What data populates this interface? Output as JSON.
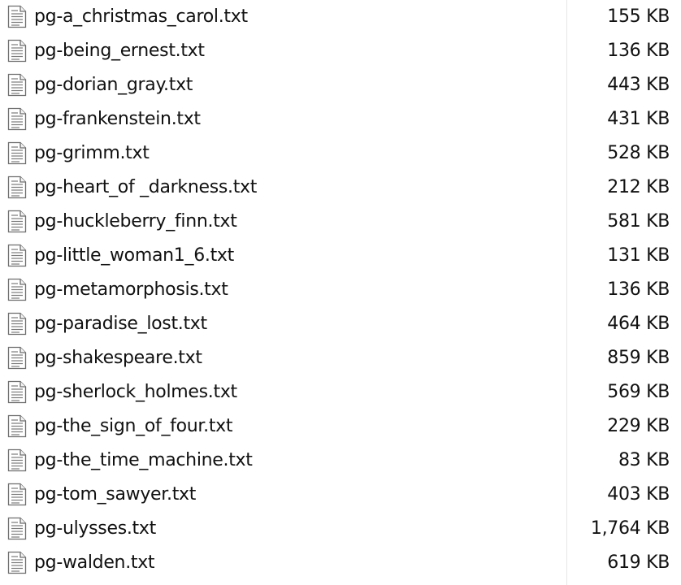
{
  "file_list": {
    "rows": [
      {
        "name": "pg-a_christmas_carol.txt",
        "size": "155 KB",
        "icon": "text-document-icon"
      },
      {
        "name": "pg-being_ernest.txt",
        "size": "136 KB",
        "icon": "text-document-icon"
      },
      {
        "name": "pg-dorian_gray.txt",
        "size": "443 KB",
        "icon": "text-document-icon"
      },
      {
        "name": "pg-frankenstein.txt",
        "size": "431 KB",
        "icon": "text-document-icon"
      },
      {
        "name": "pg-grimm.txt",
        "size": "528 KB",
        "icon": "text-document-icon"
      },
      {
        "name": "pg-heart_of _darkness.txt",
        "size": "212 KB",
        "icon": "text-document-icon"
      },
      {
        "name": "pg-huckleberry_finn.txt",
        "size": "581 KB",
        "icon": "text-document-icon"
      },
      {
        "name": "pg-little_woman1_6.txt",
        "size": "131 KB",
        "icon": "text-document-icon"
      },
      {
        "name": "pg-metamorphosis.txt",
        "size": "136 KB",
        "icon": "text-document-icon"
      },
      {
        "name": "pg-paradise_lost.txt",
        "size": "464 KB",
        "icon": "text-document-icon"
      },
      {
        "name": "pg-shakespeare.txt",
        "size": "859 KB",
        "icon": "text-document-icon"
      },
      {
        "name": "pg-sherlock_holmes.txt",
        "size": "569 KB",
        "icon": "text-document-icon"
      },
      {
        "name": "pg-the_sign_of_four.txt",
        "size": "229 KB",
        "icon": "text-document-icon"
      },
      {
        "name": "pg-the_time_machine.txt",
        "size": "83 KB",
        "icon": "text-document-icon"
      },
      {
        "name": "pg-tom_sawyer.txt",
        "size": "403 KB",
        "icon": "text-document-icon"
      },
      {
        "name": "pg-ulysses.txt",
        "size": "1,764 KB",
        "icon": "text-document-icon"
      },
      {
        "name": "pg-walden.txt",
        "size": "619 KB",
        "icon": "text-document-icon"
      }
    ]
  }
}
